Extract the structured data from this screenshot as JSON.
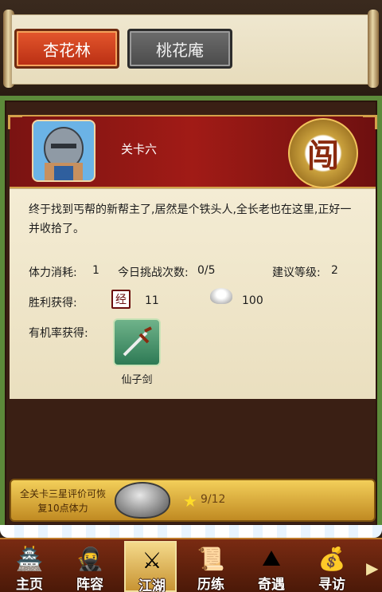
{
  "location_tabs": [
    {
      "label": "杏花林",
      "active": true
    },
    {
      "label": "桃花庵",
      "active": false
    }
  ],
  "stage": {
    "level_name": "关卡六",
    "charge_glyph": "闯",
    "description": "终于找到丐帮的新帮主了,居然是个铁头人,全长老也在这里,正好一并收拾了。",
    "stats": {
      "stamina_label": "体力消耗:",
      "stamina_value": "1",
      "daily_label": "今日挑战次数:",
      "daily_value": "0/5",
      "level_label": "建议等级:",
      "level_value": "2"
    },
    "reward": {
      "label": "胜利获得:",
      "exp_glyph": "经",
      "exp_value": "11",
      "silver_value": "100"
    },
    "chance": {
      "label": "有机率获得:",
      "item_name": "仙子剑"
    }
  },
  "star_bar": {
    "message": "全关卡三星评价可恢复10点体力",
    "progress": "9/12"
  },
  "bottom_nav": [
    {
      "label": "主页",
      "icon": "house-icon",
      "active": false
    },
    {
      "label": "阵容",
      "icon": "warrior-icon",
      "active": false
    },
    {
      "label": "江湖",
      "icon": "sword-icon",
      "active": true
    },
    {
      "label": "历练",
      "icon": "scroll-icon",
      "active": false
    },
    {
      "label": "奇遇",
      "icon": "mountain-icon",
      "active": false
    },
    {
      "label": "寻访",
      "icon": "treasure-icon",
      "active": false
    }
  ],
  "colors": {
    "header_red": "#a11b16",
    "gold": "#d4a14a",
    "panel_paper": "#f4ecd4"
  }
}
